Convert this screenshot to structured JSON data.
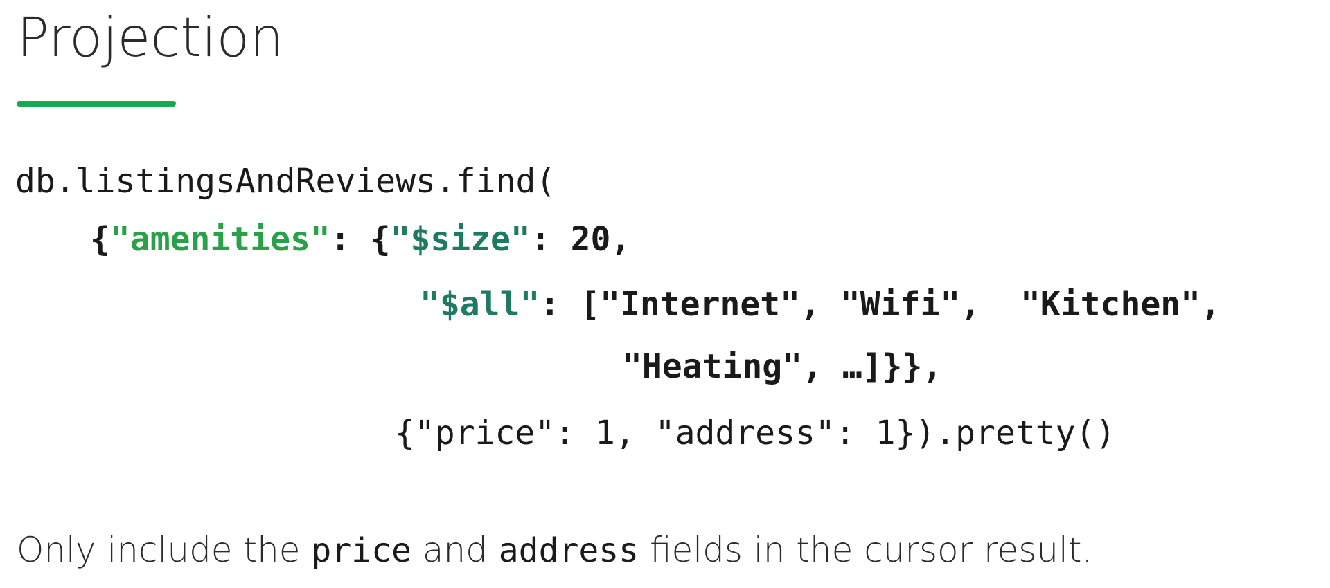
{
  "title": "Projection",
  "accent_color": "#13aa52",
  "code": {
    "line1": "db.listingsAndReviews.find(",
    "line2": {
      "open": "{",
      "key": "\"amenities\"",
      "colon": ": {",
      "op": "\"$size\"",
      "rest": ": 20,"
    },
    "line3": {
      "op": "\"$all\"",
      "colon": ": ",
      "rest": "[\"Internet\", \"Wifi\",  \"Kitchen\","
    },
    "line4": "\"Heating\", …]}},",
    "line5": "{\"price\": 1, \"address\": 1}).pretty()"
  },
  "caption": {
    "part1": "Only include the ",
    "field1": "price",
    "part2": " and ",
    "field2": "address",
    "part3": " fields in the cursor result."
  }
}
